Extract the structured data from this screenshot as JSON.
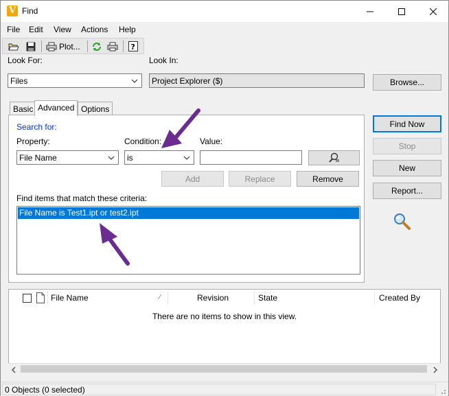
{
  "window": {
    "title": "Find",
    "app_icon_letter": "V"
  },
  "menu": [
    "File",
    "Edit",
    "View",
    "Actions",
    "Help"
  ],
  "toolbar": {
    "plot_label": "Plot..."
  },
  "look_for": {
    "label": "Look For:",
    "value": "Files"
  },
  "look_in": {
    "label": "Look In:",
    "value": "Project Explorer ($)"
  },
  "buttons": {
    "browse": "Browse...",
    "find_now": "Find Now",
    "stop": "Stop",
    "new": "New",
    "report": "Report...",
    "add": "Add",
    "replace": "Replace",
    "remove": "Remove"
  },
  "tabs": [
    "Basic",
    "Advanced",
    "Options"
  ],
  "advanced": {
    "search_for": "Search for:",
    "property_label": "Property:",
    "property_value": "File Name",
    "condition_label": "Condition:",
    "condition_value": "is",
    "value_label": "Value:",
    "value_value": "",
    "criteria_label": "Find items that match these criteria:",
    "criteria": [
      "File Name is Test1.ipt or test2.ipt"
    ]
  },
  "results": {
    "columns": [
      "File Name",
      "Revision",
      "State",
      "Created By"
    ],
    "empty_message": "There are no items to show in this view."
  },
  "status": {
    "text": "0 Objects (0 selected)"
  },
  "colors": {
    "selection": "#0078d7",
    "annotation_arrow": "#6b2c91",
    "link_text": "#0033cc"
  }
}
